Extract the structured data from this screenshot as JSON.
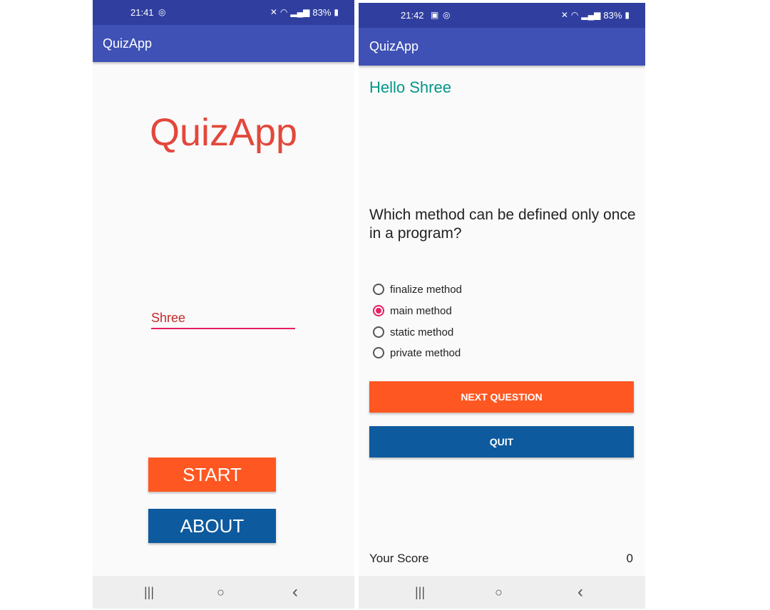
{
  "screen1": {
    "status": {
      "time": "21:41",
      "battery": "83%",
      "icons": [
        "whatsapp-icon",
        "mute-icon",
        "wifi-icon",
        "signal-icon",
        "battery-icon"
      ]
    },
    "app_title": "QuizApp",
    "big_title": "QuizApp",
    "name_input": {
      "value": "Shree"
    },
    "start_label": "START",
    "about_label": "ABOUT",
    "nav": {
      "recents": "|||",
      "home": "○",
      "back": "‹"
    }
  },
  "screen2": {
    "status": {
      "time": "21:42",
      "battery": "83%",
      "icons": [
        "gallery-icon",
        "whatsapp-icon",
        "mute-icon",
        "wifi-icon",
        "signal-icon",
        "battery-icon"
      ]
    },
    "app_title": "QuizApp",
    "greeting": "Hello Shree",
    "question": "Which method can be defined only once in a program?",
    "options": [
      {
        "label": "finalize method",
        "checked": false
      },
      {
        "label": "main method",
        "checked": true
      },
      {
        "label": "static method",
        "checked": false
      },
      {
        "label": "private method",
        "checked": false
      }
    ],
    "next_label": "NEXT QUESTION",
    "quit_label": "QUIT",
    "score_label": "Your Score",
    "score_value": "0",
    "nav": {
      "recents": "|||",
      "home": "○",
      "back": "‹"
    }
  },
  "colors": {
    "primary_dark": "#303f9f",
    "primary": "#3f51b5",
    "accent": "#e91e63",
    "orange": "#ff5722",
    "blue_button": "#0d5a9e",
    "teal": "#009688",
    "title_red": "#e2483b"
  }
}
